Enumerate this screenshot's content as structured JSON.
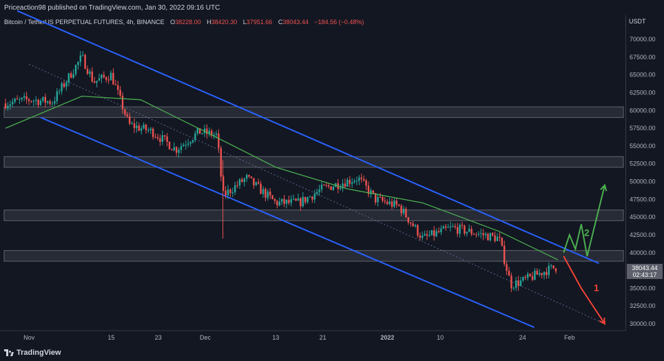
{
  "header": {
    "publisher": "Priceaction98 published on TradingView.com, Jan 30, 2022 09:16 UTC",
    "symbol": "Bitcoin / TetherUS PERPETUAL FUTURES, 4h, BINANCE",
    "ohlc": [
      {
        "label": "O",
        "value": "38228.00"
      },
      {
        "label": "H",
        "value": "38420.30"
      },
      {
        "label": "L",
        "value": "37951.66"
      },
      {
        "label": "C",
        "value": "38043.44"
      }
    ],
    "change": "−184.56 (−0.48%)"
  },
  "axis": {
    "currency": "USDT",
    "y_ticks": [
      "70000.00",
      "67500.00",
      "65000.00",
      "62500.00",
      "60000.00",
      "57500.00",
      "55000.00",
      "52500.00",
      "50000.00",
      "47500.00",
      "45000.00",
      "42500.00",
      "40000.00",
      "35000.00",
      "32500.00",
      "30000.00"
    ],
    "x_ticks": [
      "Nov",
      "15",
      "23",
      "Dec",
      "13",
      "21",
      "2022",
      "10",
      "24",
      "Feb"
    ]
  },
  "last_price": {
    "price": "38043.44",
    "countdown": "02:43:17"
  },
  "branding": {
    "logo_text": "TradingView"
  },
  "colors": {
    "background": "#131722",
    "up": "#26a69a",
    "down": "#ef5350",
    "ma": "#4caf50",
    "channel": "#2962ff",
    "scenario_up": "#4caf50",
    "scenario_down": "#f44336",
    "zone": "#2a2e39"
  },
  "chart_data": {
    "type": "candlestick",
    "ylim": [
      29000,
      72000
    ],
    "y_scale": "linear",
    "grid": false,
    "x_labels": [
      "Nov",
      "15",
      "23",
      "Dec",
      "13",
      "21",
      "2022",
      "10",
      "24",
      "Feb"
    ],
    "price_path": [
      {
        "t": "Oct 28",
        "close": 61000
      },
      {
        "t": "Nov 1",
        "close": 61500
      },
      {
        "t": "Nov 5",
        "close": 61200
      },
      {
        "t": "Nov 10",
        "close": 67500
      },
      {
        "t": "Nov 12",
        "close": 64000
      },
      {
        "t": "Nov 15",
        "close": 65000
      },
      {
        "t": "Nov 18",
        "close": 58000
      },
      {
        "t": "Nov 22",
        "close": 57000
      },
      {
        "t": "Nov 26",
        "close": 54500
      },
      {
        "t": "Nov 30",
        "close": 57000
      },
      {
        "t": "Dec 3",
        "close": 56500
      },
      {
        "t": "Dec 4",
        "close": 48000
      },
      {
        "t": "Dec 8",
        "close": 50500
      },
      {
        "t": "Dec 13",
        "close": 47000
      },
      {
        "t": "Dec 17",
        "close": 47000
      },
      {
        "t": "Dec 21",
        "close": 49000
      },
      {
        "t": "Dec 27",
        "close": 50500
      },
      {
        "t": "Dec 30",
        "close": 47500
      },
      {
        "t": "Jan 3",
        "close": 46500
      },
      {
        "t": "Jan 7",
        "close": 42000
      },
      {
        "t": "Jan 12",
        "close": 43500
      },
      {
        "t": "Jan 20",
        "close": 42000
      },
      {
        "t": "Jan 22",
        "close": 35500
      },
      {
        "t": "Jan 24",
        "close": 36000
      },
      {
        "t": "Jan 28",
        "close": 37500
      },
      {
        "t": "Jan 30",
        "close": 38043
      }
    ],
    "overlays": {
      "moving_average": [
        {
          "t": "Oct 28",
          "v": 57500
        },
        {
          "t": "Nov 10",
          "v": 62000
        },
        {
          "t": "Nov 20",
          "v": 61500
        },
        {
          "t": "Dec 1",
          "v": 57000
        },
        {
          "t": "Dec 13",
          "v": 52000
        },
        {
          "t": "Dec 25",
          "v": 49000
        },
        {
          "t": "Jan 7",
          "v": 47000
        },
        {
          "t": "Jan 20",
          "v": 43000
        },
        {
          "t": "Jan 30",
          "v": 39000
        }
      ],
      "zones": [
        {
          "low": 59000,
          "high": 60500
        },
        {
          "low": 52000,
          "high": 53500
        },
        {
          "low": 44500,
          "high": 46000
        },
        {
          "low": 38800,
          "high": 40300
        }
      ],
      "channel_lines": [
        {
          "from": {
            "t": "Oct 30",
            "v": 74000
          },
          "to": {
            "t": "Feb 6",
            "v": 38500
          }
        },
        {
          "from": {
            "t": "Nov 3",
            "v": 59000
          },
          "to": {
            "t": "Jan 26",
            "v": 29500
          }
        }
      ],
      "channel_midline": {
        "from": {
          "t": "Nov 1",
          "v": 66500
        },
        "to": {
          "t": "Feb 7",
          "v": 30000
        }
      },
      "scenarios": [
        {
          "label": "1",
          "points": [
            {
              "t": "Jan 31",
              "v": 39500
            },
            {
              "t": "Feb 3",
              "v": 35000
            },
            {
              "t": "Feb 7",
              "v": 30000
            }
          ]
        },
        {
          "label": "2",
          "points": [
            {
              "t": "Jan 31",
              "v": 40000
            },
            {
              "t": "Feb 1",
              "v": 42500
            },
            {
              "t": "Feb 2",
              "v": 40500
            },
            {
              "t": "Feb 3",
              "v": 44000
            },
            {
              "t": "Feb 4",
              "v": 39500
            },
            {
              "t": "Feb 7",
              "v": 49500
            }
          ]
        }
      ]
    }
  }
}
